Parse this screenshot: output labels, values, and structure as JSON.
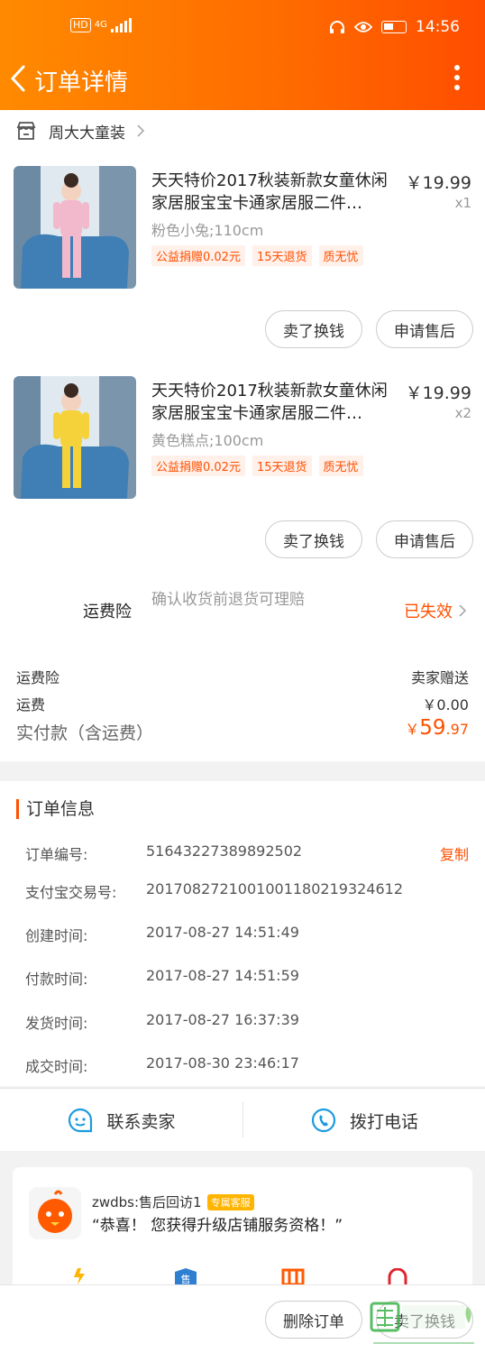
{
  "status_bar": {
    "network": "4G",
    "hd": "HD",
    "time": "14:56"
  },
  "header": {
    "title": "订单详情"
  },
  "shop": {
    "name": "周大大童装"
  },
  "items": [
    {
      "title": "天天特价2017秋装新款女童休闲家居服宝宝卡通家居服二件…",
      "price": "￥19.99",
      "qty": "x1",
      "sku": "粉色小兔;110cm",
      "tags": [
        "公益捐赠0.02元",
        "15天退货",
        "质无忧"
      ],
      "buttons": [
        "卖了换钱",
        "申请售后"
      ],
      "image_color": "#f2b8cc"
    },
    {
      "title": "天天特价2017秋装新款女童休闲家居服宝宝卡通家居服二件…",
      "price": "￥19.99",
      "qty": "x2",
      "sku": "黄色糕点;100cm",
      "tags": [
        "公益捐赠0.02元",
        "15天退货",
        "质无忧"
      ],
      "buttons": [
        "卖了换钱",
        "申请售后"
      ],
      "image_color": "#f5d23a"
    }
  ],
  "insurance": {
    "label": "运费险",
    "desc": "确认收货前退货可理赔",
    "status": "已失效"
  },
  "fees": {
    "insurance_label": "运费险",
    "insurance_value": "卖家赠送",
    "shipping_label": "运费",
    "shipping_value": "￥0.00",
    "total_label": "实付款（含运费）",
    "total_currency": "￥",
    "total_int": "59",
    "total_dec": ".97"
  },
  "order_info": {
    "title": "订单信息",
    "copy_label": "复制",
    "rows": [
      {
        "k": "订单编号:",
        "v": "51643227389892502"
      },
      {
        "k": "支付宝交易号:",
        "v": "2017082721001001180219324612"
      },
      {
        "k": "创建时间:",
        "v": "2017-08-27 14:51:49"
      },
      {
        "k": "付款时间:",
        "v": "2017-08-27 14:51:59"
      },
      {
        "k": "发货时间:",
        "v": "2017-08-27 16:37:39"
      },
      {
        "k": "成交时间:",
        "v": "2017-08-30 23:46:17"
      }
    ]
  },
  "contact": {
    "seller": "联系卖家",
    "call": "拨打电话"
  },
  "bot": {
    "name": "zwdbs:售后回访1",
    "badge": "专属客服",
    "message": "“恭喜！ 您获得升级店铺服务资格！”"
  },
  "bottom": {
    "delete": "删除订单",
    "sell": "卖了换钱"
  },
  "colors": {
    "accent": "#ff5000",
    "header_start": "#ff8a00",
    "header_end": "#ff4d00"
  }
}
